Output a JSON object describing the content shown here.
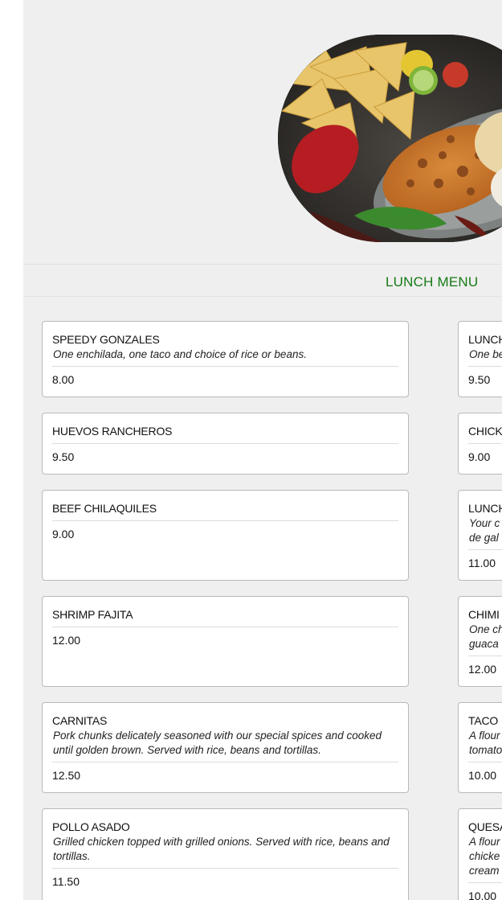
{
  "menu": {
    "title": "LUNCH MENU"
  },
  "hero": {
    "image_alt": "food-photo"
  },
  "left_items": [
    {
      "name": "SPEEDY GONZALES",
      "desc": "One enchilada, one taco and choice of rice or beans.",
      "price": "8.00"
    },
    {
      "name": "HUEVOS RANCHEROS",
      "desc": "",
      "price": "9.50"
    },
    {
      "name": "BEEF CHILAQUILES",
      "desc": "",
      "price": "9.00"
    },
    {
      "name": "SHRIMP FAJITA",
      "desc": "",
      "price": "12.00"
    },
    {
      "name": "CARNITAS",
      "desc": "Pork chunks delicately seasoned with our special spices and cooked until golden brown. Served with rice, beans and tortillas.",
      "price": "12.50"
    },
    {
      "name": "POLLO ASADO",
      "desc": "Grilled chicken topped with grilled onions. Served with rice, beans and tortillas.",
      "price": "11.50"
    }
  ],
  "right_items": [
    {
      "name": "LUNCH",
      "desc": "One be",
      "price": "9.50"
    },
    {
      "name": "CHICK",
      "desc": "",
      "price": "9.00"
    },
    {
      "name": "LUNCH",
      "desc": "Your c\nde gal",
      "price": "11.00"
    },
    {
      "name": "CHIMI",
      "desc": "One ch\nguaca",
      "price": "12.00"
    },
    {
      "name": "TACO",
      "desc": "A flour\ntomato",
      "price": "10.00"
    },
    {
      "name": "QUESA",
      "desc": "A flour\nchicke\ncream",
      "price": "10.00"
    }
  ]
}
